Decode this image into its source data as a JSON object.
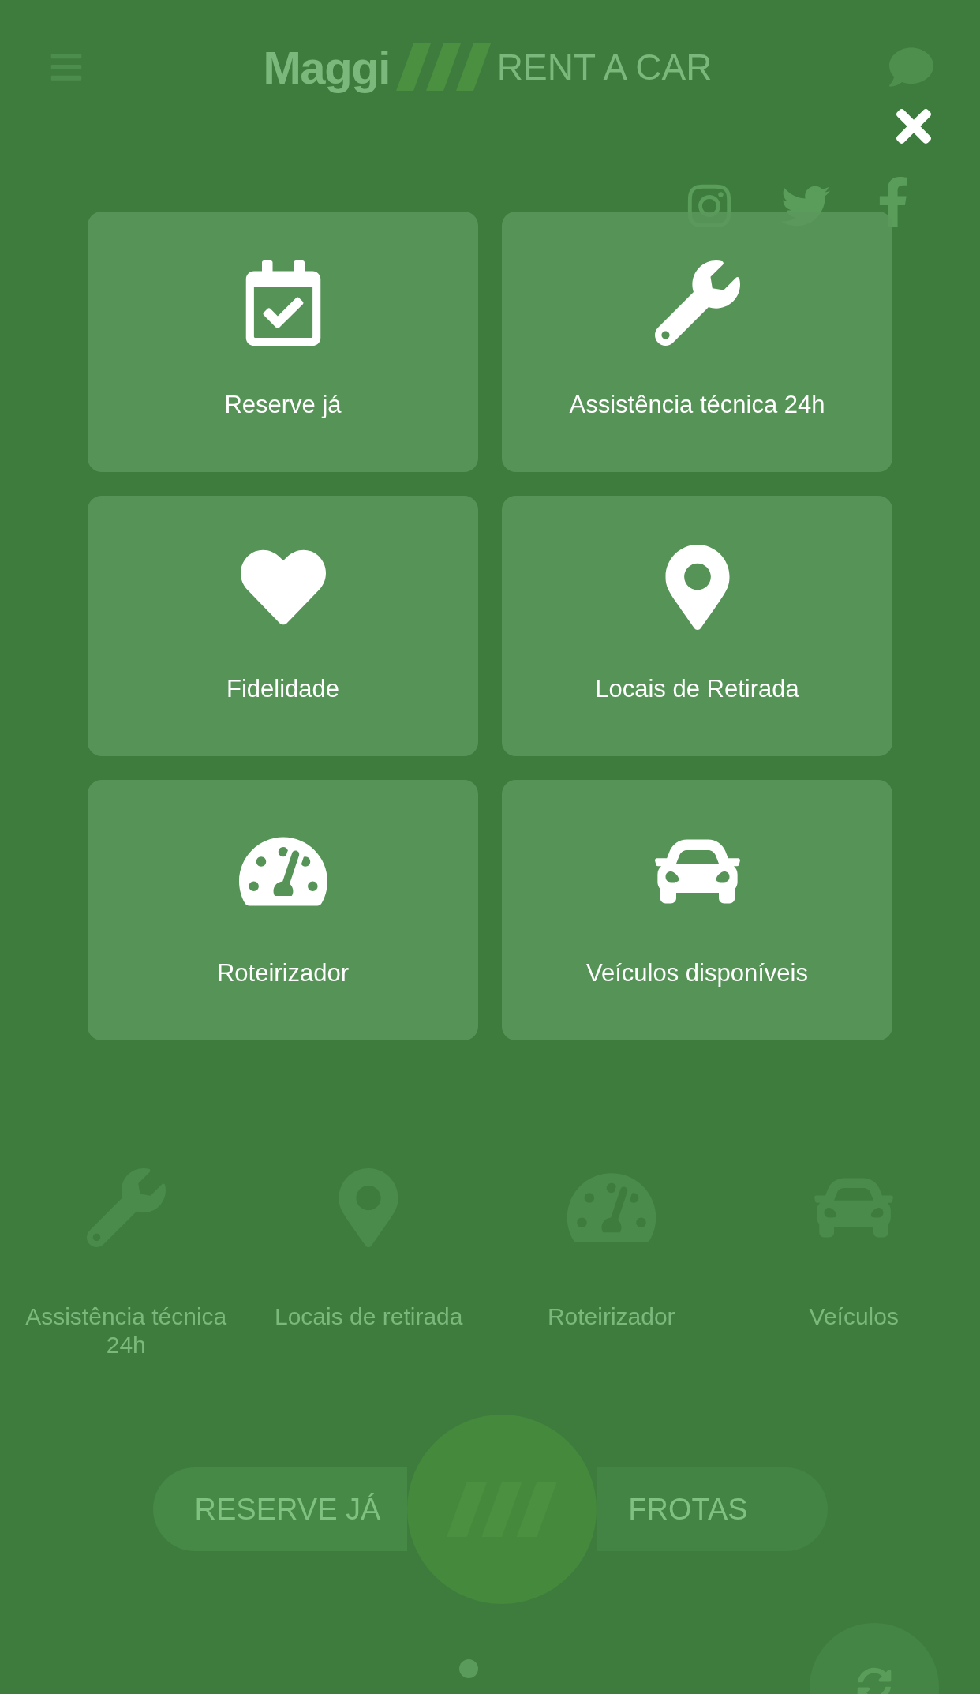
{
  "header": {
    "logo_name": "Maggi",
    "logo_tagline": "RENT A CAR"
  },
  "features": [
    {
      "kind": "wrench",
      "label": "Assistência técnica 24h"
    },
    {
      "kind": "pin",
      "label": "Locais de retirada"
    },
    {
      "kind": "gauge",
      "label": "Roteirizador"
    },
    {
      "kind": "car",
      "label": "Veículos"
    }
  ],
  "actions": [
    {
      "label": "RESERVE JÁ"
    },
    {
      "label": "FROTAS"
    }
  ],
  "menu": {
    "items": [
      {
        "kind": "calendar",
        "label": "Reserve já"
      },
      {
        "kind": "wrench",
        "label": "Assistência técnica 24h"
      },
      {
        "kind": "heart",
        "label": "Fidelidade"
      },
      {
        "kind": "pin",
        "label": "Locais de Retirada"
      },
      {
        "kind": "gauge",
        "label": "Roteirizador"
      },
      {
        "kind": "car",
        "label": "Veículos disponíveis"
      }
    ]
  }
}
